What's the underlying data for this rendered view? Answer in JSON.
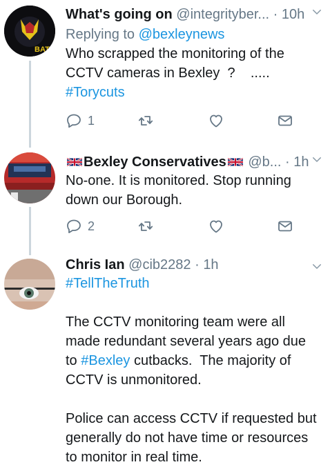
{
  "tweets": [
    {
      "name": "What's going on",
      "handle": "@integrityber...",
      "dot": "·",
      "time": "10h",
      "reply_prefix": "Replying to ",
      "reply_handle": "@bexleynews",
      "text_line1": "Who scrapped the monitoring of the",
      "text_line2": "CCTV cameras in Bexley  ?    .....",
      "hashtag": "#Torycuts",
      "reply_count": "1",
      "avatar_label": "BAT"
    },
    {
      "name": "Bexley Conservatives",
      "handle": "@b...",
      "dot": "·",
      "time": "1h",
      "text_line1": "No-one. It is monitored. Stop running",
      "text_line2": "down our Borough.",
      "reply_count": "2"
    },
    {
      "name": "Chris Ian",
      "handle": "@cib2282",
      "dot": "·",
      "time": "1h",
      "hashtag": "#TellTheTruth",
      "p1_line1": "The CCTV monitoring team were all",
      "p1_line2": "made redundant several years ago due",
      "p1_line3_pre": "to ",
      "p1_line3_tag": "#Bexley",
      "p1_line3_post": " cutbacks.  The majority of",
      "p1_line4": "CCTV is unmonitored.",
      "p2_line1": "Police can access CCTV if requested but",
      "p2_line2": "generally do not have time or resources",
      "p2_line3": "to monitor in real time."
    }
  ],
  "icons": [
    "reply-icon",
    "retweet-icon",
    "like-icon",
    "dm-icon",
    "chevron-down-icon",
    "uk-flag-icon"
  ],
  "colors": {
    "link": "#1b95e0",
    "muted": "#657786",
    "line": "#ccd6dd"
  }
}
